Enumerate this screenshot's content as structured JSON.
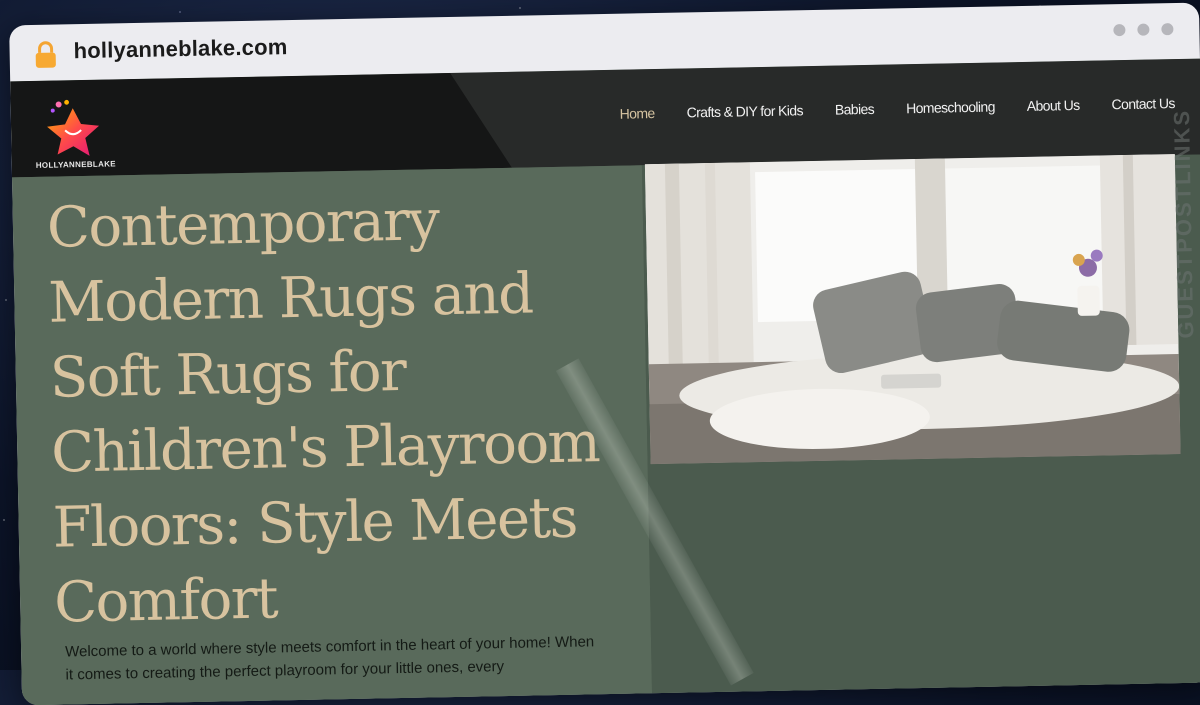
{
  "browser": {
    "url": "hollyanneblake.com"
  },
  "site": {
    "logo_text": "HOLLYANNEBLAKE",
    "nav": [
      {
        "label": "Home",
        "active": true
      },
      {
        "label": "Crafts & DIY for Kids",
        "active": false
      },
      {
        "label": "Babies",
        "active": false
      },
      {
        "label": "Homeschooling",
        "active": false
      },
      {
        "label": "About Us",
        "active": false
      },
      {
        "label": "Contact Us",
        "active": false
      }
    ]
  },
  "hero": {
    "title": "Contemporary Modern Rugs and Soft Rugs for Children's Playroom Floors: Style Meets Comfort",
    "intro": "Welcome to a world where style meets comfort in the heart of your home! When it comes to creating the perfect playroom for your little ones, every"
  },
  "watermark": {
    "text": "GUESTPOSTLINKS"
  },
  "colors": {
    "accent": "#d8c39f",
    "header_bg": "#282a29",
    "hero_bg": "#596a5b",
    "nav_active": "#d5c3a1"
  }
}
